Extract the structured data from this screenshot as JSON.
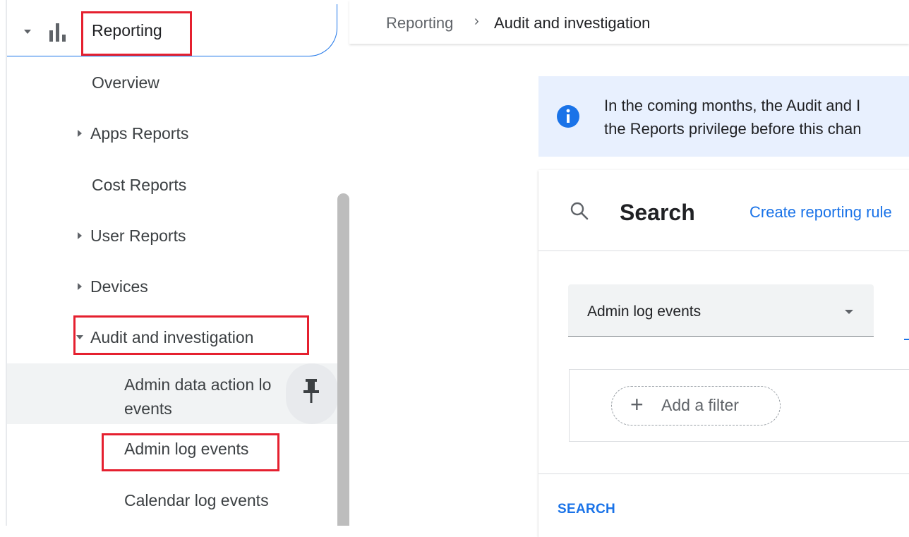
{
  "sidebar": {
    "reporting_label": "Reporting",
    "items": [
      {
        "label": "Overview"
      },
      {
        "label": "Apps Reports"
      },
      {
        "label": "Cost Reports"
      },
      {
        "label": "User Reports"
      },
      {
        "label": "Devices"
      },
      {
        "label": "Audit and investigation"
      }
    ],
    "sub_items": [
      {
        "label_line1": "Admin data action lo",
        "label_line2": "events"
      },
      {
        "label": "Admin log events"
      },
      {
        "label": "Calendar log events"
      }
    ]
  },
  "breadcrumb": {
    "root": "Reporting",
    "separator": "›",
    "current": "Audit and investigation"
  },
  "banner": {
    "line1": "In the coming months, the Audit and I",
    "line2": "the Reports privilege before this chan"
  },
  "search_card": {
    "title": "Search",
    "create_link": "Create reporting rule",
    "data_source_value": "Admin log events",
    "add_filter_label": "Add a filter",
    "search_button": "SEARCH"
  },
  "colors": {
    "accent": "#1a73e8",
    "highlight": "#e5202f",
    "banner_bg": "#e8f0fe"
  }
}
